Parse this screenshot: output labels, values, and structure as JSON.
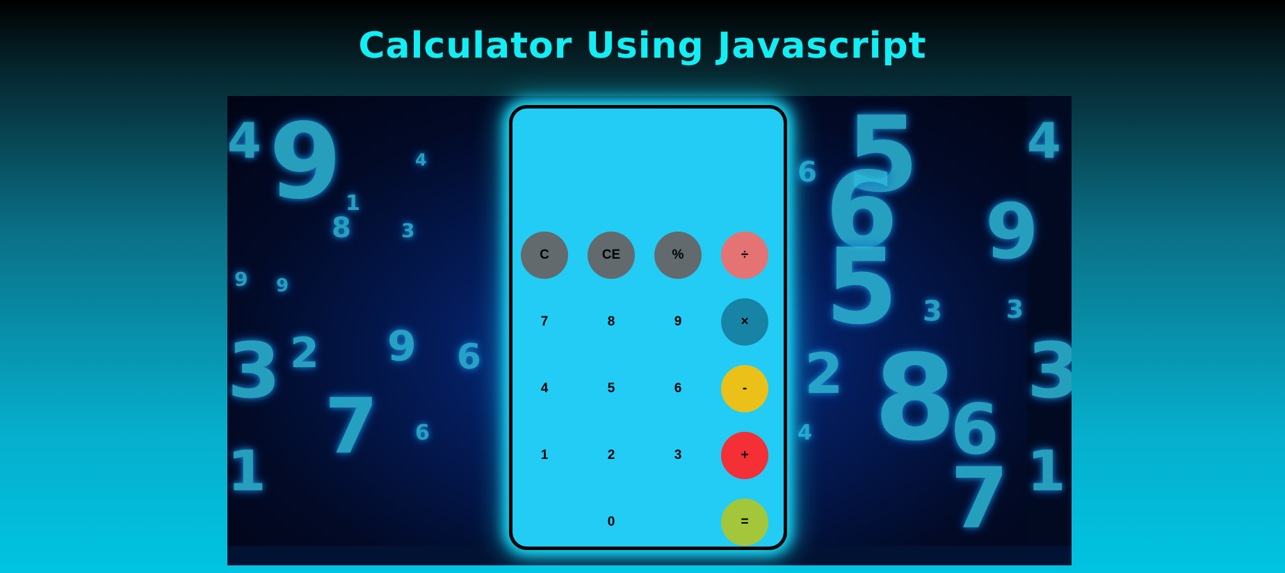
{
  "page": {
    "title": "Calculator Using Javascript"
  },
  "calculator": {
    "display_value": "",
    "buttons": {
      "clear": "C",
      "clear_entry": "CE",
      "percent": "%",
      "divide": "÷",
      "seven": "7",
      "eight": "8",
      "nine": "9",
      "multiply": "×",
      "four": "4",
      "five": "5",
      "six": "6",
      "subtract": "-",
      "one": "1",
      "two": "2",
      "three": "3",
      "add": "+",
      "zero": "0",
      "equals": "="
    }
  },
  "colors": {
    "title": "#12eef4",
    "calculator_body": "#22ccf5",
    "glow": "#18e3ff",
    "function_buttons": "#626a6e",
    "divide_button": "#e57373",
    "multiply_button": "#1784a6",
    "subtract_button": "#ebc018",
    "add_button": "#f42f35",
    "equals_button": "#a4c63a"
  },
  "background": {
    "description_icon": "floating-digits-background"
  }
}
